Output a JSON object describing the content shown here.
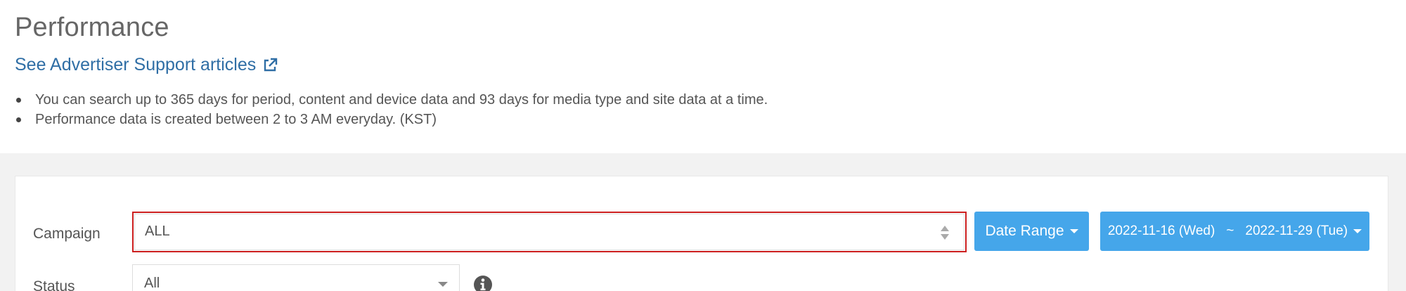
{
  "page": {
    "title": "Performance",
    "support_link": "See Advertiser Support articles",
    "notes": [
      "You can search up to 365 days for period, content and device data and 93 days for media type and site data at a time.",
      "Performance data is created between 2 to 3 AM everyday. (KST)"
    ]
  },
  "filters": {
    "campaign_label": "Campaign",
    "campaign_value": "ALL",
    "status_label": "Status",
    "status_value": "All",
    "date_range_label": "Date Range",
    "date_start": "2022-11-16 (Wed)",
    "date_separator": "~",
    "date_end": "2022-11-29 (Tue)"
  },
  "icons": {
    "external_link": "external-link-icon",
    "sort": "sort-icon",
    "info": "info-icon"
  },
  "colors": {
    "link": "#2f6ea5",
    "button": "#45a6ea",
    "highlight": "#cc1f1f"
  }
}
